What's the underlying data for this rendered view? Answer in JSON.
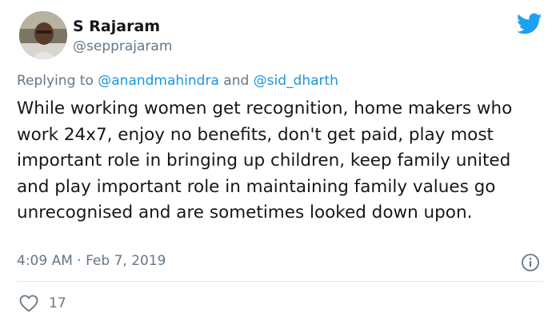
{
  "author": {
    "name": "S Rajaram",
    "handle": "@sepprajaram",
    "avatar_icon": "user-avatar"
  },
  "reply": {
    "prefix": "Replying to",
    "mention_1": "@anandmahindra",
    "joiner": "and",
    "mention_2": "@sid_dharth"
  },
  "tweet": {
    "text": "While working women get recognition, home makers who work 24x7, enjoy no benefits, don't get paid, play most important role in bringing up children, keep family united and play important role in maintaining family values go unrecognised and are sometimes looked down upon."
  },
  "meta": {
    "timestamp": "4:09 AM · Feb 7, 2019"
  },
  "actions": {
    "like_count": "17"
  },
  "icons": {
    "brand": "twitter-bird-icon",
    "info": "info-icon",
    "like": "heart-icon"
  },
  "colors": {
    "brand_blue": "#1da1f2",
    "mention_blue": "#1b95e0",
    "secondary_text": "#657786",
    "primary_text": "#14171a",
    "divider": "#e1e8ed"
  }
}
